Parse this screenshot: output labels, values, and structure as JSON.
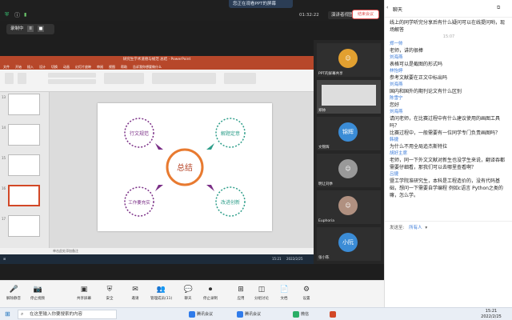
{
  "meeting": {
    "share_banner": "您正在观看PPT的屏幕",
    "timer": "01:32:22",
    "view_label": "演讲者视图",
    "recording_label": "录制中",
    "pause_glyph": "II",
    "stop_glyph": "■"
  },
  "ppt": {
    "title_bar": "研究生学术道德与规范 总结 · PowerPoint",
    "tabs": [
      "文件",
      "开始",
      "插入",
      "设计",
      "切换",
      "动画",
      "幻灯片放映",
      "审阅",
      "视图",
      "帮助",
      "告诉我你想要做什么"
    ],
    "slide_numbers": [
      "13",
      "14",
      "15",
      "16",
      "17"
    ],
    "status_left": "幻灯片 16 / 17",
    "status_right": "单击此处添加备注",
    "taskbar_time": "15:21",
    "taskbar_date": "2022/2/25",
    "slide": {
      "center": "总结",
      "nodes": [
        "行文规范",
        "解题定意",
        "工作要充实",
        "改进创新"
      ]
    },
    "colors": {
      "accent": "#b7472a",
      "center_ring": "#e87a30",
      "purple": "#7a2e86",
      "teal": "#2e9e8a"
    }
  },
  "participants": [
    {
      "name": "PPT的屏幕共享",
      "avatar": "",
      "color": "#e2a030"
    },
    {
      "name": "郑帅",
      "avatar": "",
      "color": "#555"
    },
    {
      "name": "文锦辉",
      "avatar": "锦辉",
      "color": "#3b8cd6"
    },
    {
      "name": "明让刘季",
      "avatar": "",
      "color": "#666"
    },
    {
      "name": "Euphoria",
      "avatar": "",
      "color": "#777"
    },
    {
      "name": "张小陈",
      "avatar": "小阮",
      "color": "#3b8cd6"
    }
  ],
  "toolbar": {
    "items": [
      {
        "label": "解除静音",
        "icon": "mic-icon",
        "glyph": "🎤"
      },
      {
        "label": "停止视频",
        "icon": "camera-icon",
        "glyph": "📷"
      },
      {
        "label": "共享屏幕",
        "icon": "share-screen-icon",
        "glyph": "▣"
      },
      {
        "label": "安全",
        "icon": "shield-icon",
        "glyph": "⛨"
      },
      {
        "label": "邀请",
        "icon": "invite-icon",
        "glyph": "✉"
      },
      {
        "label": "管理成员(11)",
        "icon": "members-icon",
        "glyph": "👥"
      },
      {
        "label": "聊天",
        "icon": "chat-icon",
        "glyph": "💬"
      },
      {
        "label": "停止录制",
        "icon": "record-icon",
        "glyph": "⏺"
      },
      {
        "label": "应用",
        "icon": "apps-icon",
        "glyph": "⊞"
      },
      {
        "label": "分组讨论",
        "icon": "breakout-icon",
        "glyph": "◫"
      },
      {
        "label": "文档",
        "icon": "docs-icon",
        "glyph": "📄"
      },
      {
        "label": "设置",
        "icon": "gear-icon",
        "glyph": "⚙"
      }
    ],
    "end_label": "结束会议"
  },
  "chat": {
    "title": "聊天",
    "messages": [
      {
        "type": "text",
        "text": "线上的同学听完分享后有什么疑问可以在线提问哟，现场解答"
      },
      {
        "type": "time",
        "text": "15:07"
      },
      {
        "type": "sender",
        "text": "郑一帅"
      },
      {
        "type": "text",
        "text": "老师，讲的很棒"
      },
      {
        "type": "sender",
        "text": "刘海燕"
      },
      {
        "type": "text",
        "text": "表格可以是截图的形式吗"
      },
      {
        "type": "sender",
        "text": "林怡婷"
      },
      {
        "type": "text",
        "text": "参考文献要在正文中标出吗"
      },
      {
        "type": "sender",
        "text": "刘海燕"
      },
      {
        "type": "text",
        "text": "国内和国外的期刊论文有什么区别"
      },
      {
        "type": "sender",
        "text": "陈雪宁"
      },
      {
        "type": "text",
        "text": "您好"
      },
      {
        "type": "sender",
        "text": "刘海燕"
      },
      {
        "type": "text",
        "text": "请问老师，在比赛过程中有什么建议使用的画图工具吗？"
      },
      {
        "type": "text",
        "text": "比赛过程中，一般需要有一位同学专门负责画图吗？"
      },
      {
        "type": "sender",
        "text": "韩捷"
      },
      {
        "type": "text",
        "text": "为什么不用全局追杰斯特拉"
      },
      {
        "type": "sender",
        "text": "胡好主席"
      },
      {
        "type": "text",
        "text": "老师，同一下外文文献对新生也没学生来说，翻译吞都需要仔细看，那我们可以去哪里查看啊？"
      },
      {
        "type": "sender",
        "text": "吕捷"
      },
      {
        "type": "text",
        "text": "暨工学院准研究生，本科是工程造价的，没有代码基础，想问一下需要自学编程 例如c语言 Python之类的嘛，怎么学。"
      }
    ],
    "send_to_label": "发送至:",
    "send_to_value": "所有人"
  },
  "taskbar": {
    "search_placeholder": "在这里输入你要搜索的内容",
    "apps": [
      {
        "label": "腾讯会议",
        "color": "#2f7bea"
      },
      {
        "label": "腾讯会议",
        "color": "#2f7bea"
      },
      {
        "label": "微信",
        "color": "#2aae67"
      },
      {
        "label": "",
        "color": "#d24726"
      }
    ],
    "time": "15:21",
    "date": "2022/2/25"
  }
}
